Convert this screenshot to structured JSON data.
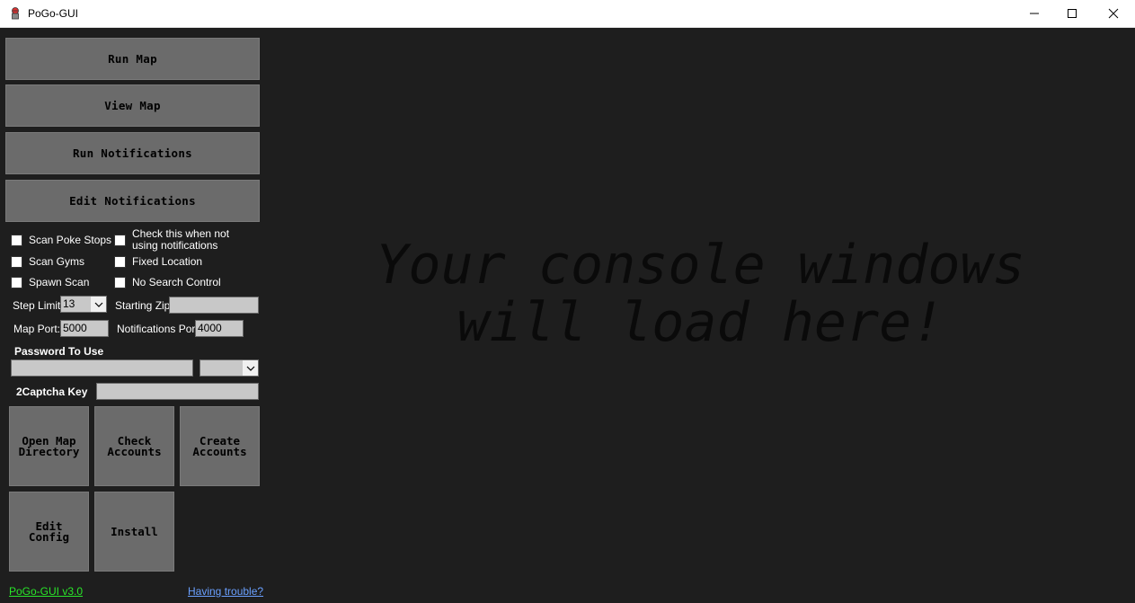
{
  "window": {
    "title": "PoGo-GUI",
    "icon": "pokeball-figure-icon"
  },
  "buttons": {
    "run_map": "Run Map",
    "view_map": "View Map",
    "run_notifications": "Run Notifications",
    "edit_notifications": "Edit Notifications",
    "open_map_directory": "Open Map\nDirectory",
    "check_accounts": "Check\nAccounts",
    "create_accounts": "Create\nAccounts",
    "edit_config": "Edit\nConfig",
    "install": "Install"
  },
  "checkboxes": {
    "scan_poke_stops": "Scan Poke Stops",
    "scan_gyms": "Scan Gyms",
    "spawn_scan": "Spawn Scan",
    "no_notifications": "Check this when not using notifications",
    "fixed_location": "Fixed Location",
    "no_search_control": "No Search Control"
  },
  "fields": {
    "step_limit_label": "Step Limit:",
    "step_limit_value": "13",
    "starting_zip_label": "Starting Zip:",
    "starting_zip_value": "",
    "map_port_label": "Map Port:",
    "map_port_value": "5000",
    "notifications_port_label": "Notifications Port:",
    "notifications_port_value": "4000",
    "password_label": "Password To Use",
    "password_value": "",
    "password_select_value": "",
    "captcha_label": "2Captcha Key",
    "captcha_value": ""
  },
  "footer": {
    "version": "PoGo-GUI v3.0",
    "having_trouble": "Having trouble?"
  },
  "console": {
    "message": "Your console windows\nwill load here!"
  },
  "colors": {
    "background": "#1e1e1e",
    "button": "#6b6b6b",
    "version_link": "#29e629",
    "trouble_link": "#6aa0ff"
  }
}
